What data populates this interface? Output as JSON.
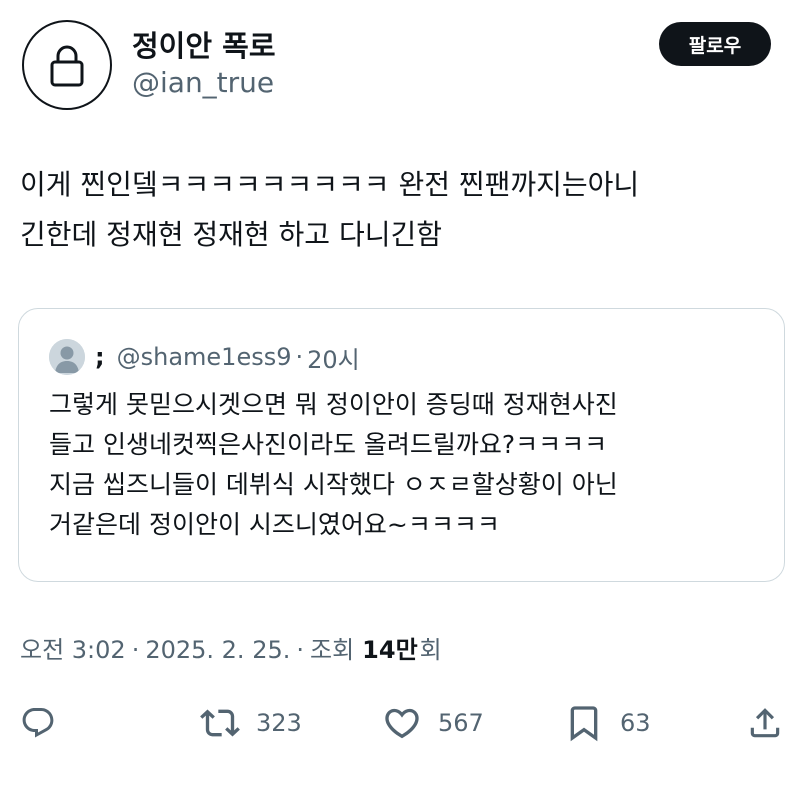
{
  "author": {
    "display_name": "정이안 폭로",
    "handle": "@ian_true",
    "avatar_icon": "lock-icon"
  },
  "follow_button": {
    "label": "팔로우"
  },
  "tweet": {
    "text": "이게 찐인뎈ㅋㅋㅋㅋㅋㅋㅋㅋㅋ 완전 찐팬까지는아니\n긴한데 정재현 정재현 하고 다니긴함"
  },
  "quote": {
    "name": ";",
    "handle": "@shame1ess9",
    "separator": "·",
    "time": "20시",
    "text": "그렇게 못믿으시겟으면 뭐 정이안이 증딩때 정재현사진\n들고 인생네컷찍은사진이라도 올려드릴까요?ㅋㅋㅋㅋ\n지금 씹즈니들이 데뷔식 시작했다 ㅇㅈㄹ할상황이 아닌\n거같은데 정이안이 시즈니였어요~ㅋㅋㅋㅋ"
  },
  "meta": {
    "time": "오전 3:02",
    "separator": "·",
    "date": "2025. 2. 25.",
    "views_label": "조회",
    "views_count": "14만",
    "views_suffix": "회"
  },
  "actions": {
    "reply": {
      "icon": "reply-icon"
    },
    "retweet": {
      "icon": "retweet-icon",
      "count": "323"
    },
    "like": {
      "icon": "heart-icon",
      "count": "567"
    },
    "bookmark": {
      "icon": "bookmark-icon",
      "count": "63"
    },
    "share": {
      "icon": "share-icon"
    }
  },
  "colors": {
    "text_primary": "#0f1419",
    "text_secondary": "#536471",
    "border": "#cfd9de",
    "follow_bg": "#0f1419",
    "follow_text": "#ffffff"
  }
}
